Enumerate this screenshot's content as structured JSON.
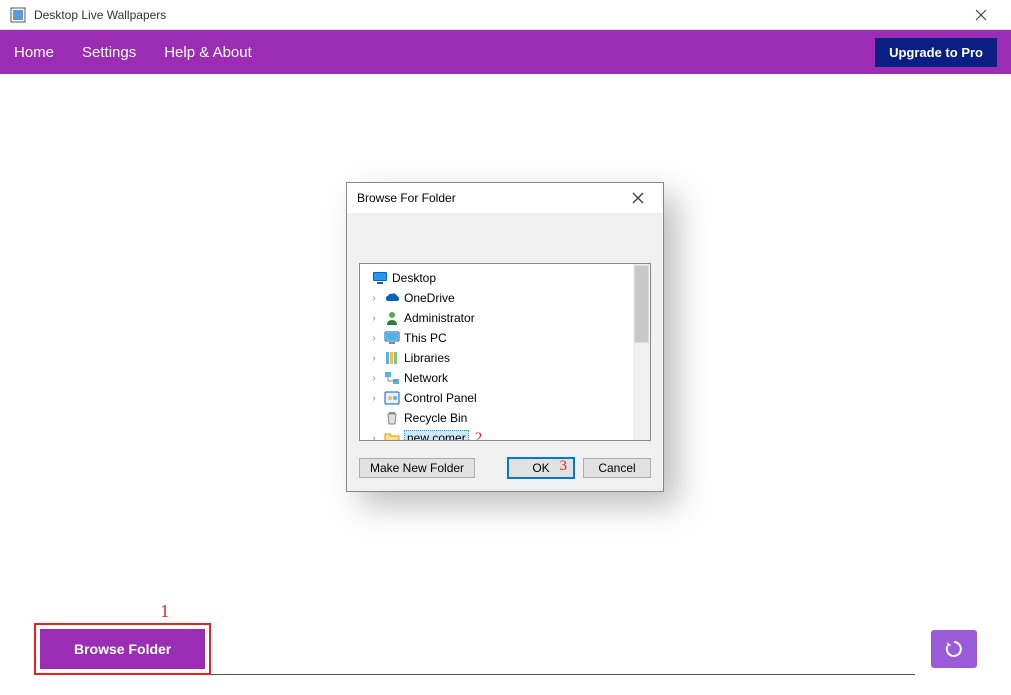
{
  "app": {
    "title": "Desktop Live Wallpapers"
  },
  "nav": {
    "home": "Home",
    "settings": "Settings",
    "help": "Help & About",
    "upgrade": "Upgrade to Pro"
  },
  "dialog": {
    "title": "Browse For Folder",
    "make_new": "Make New Folder",
    "ok": "OK",
    "cancel": "Cancel",
    "tree": {
      "desktop": "Desktop",
      "onedrive": "OneDrive",
      "admin": "Administrator",
      "thispc": "This PC",
      "libraries": "Libraries",
      "network": "Network",
      "controlpanel": "Control Panel",
      "recyclebin": "Recycle Bin",
      "newcomer": "new comer"
    }
  },
  "buttons": {
    "browse_folder": "Browse Folder"
  },
  "annotations": {
    "one": "1",
    "two": "2",
    "three": "3"
  }
}
